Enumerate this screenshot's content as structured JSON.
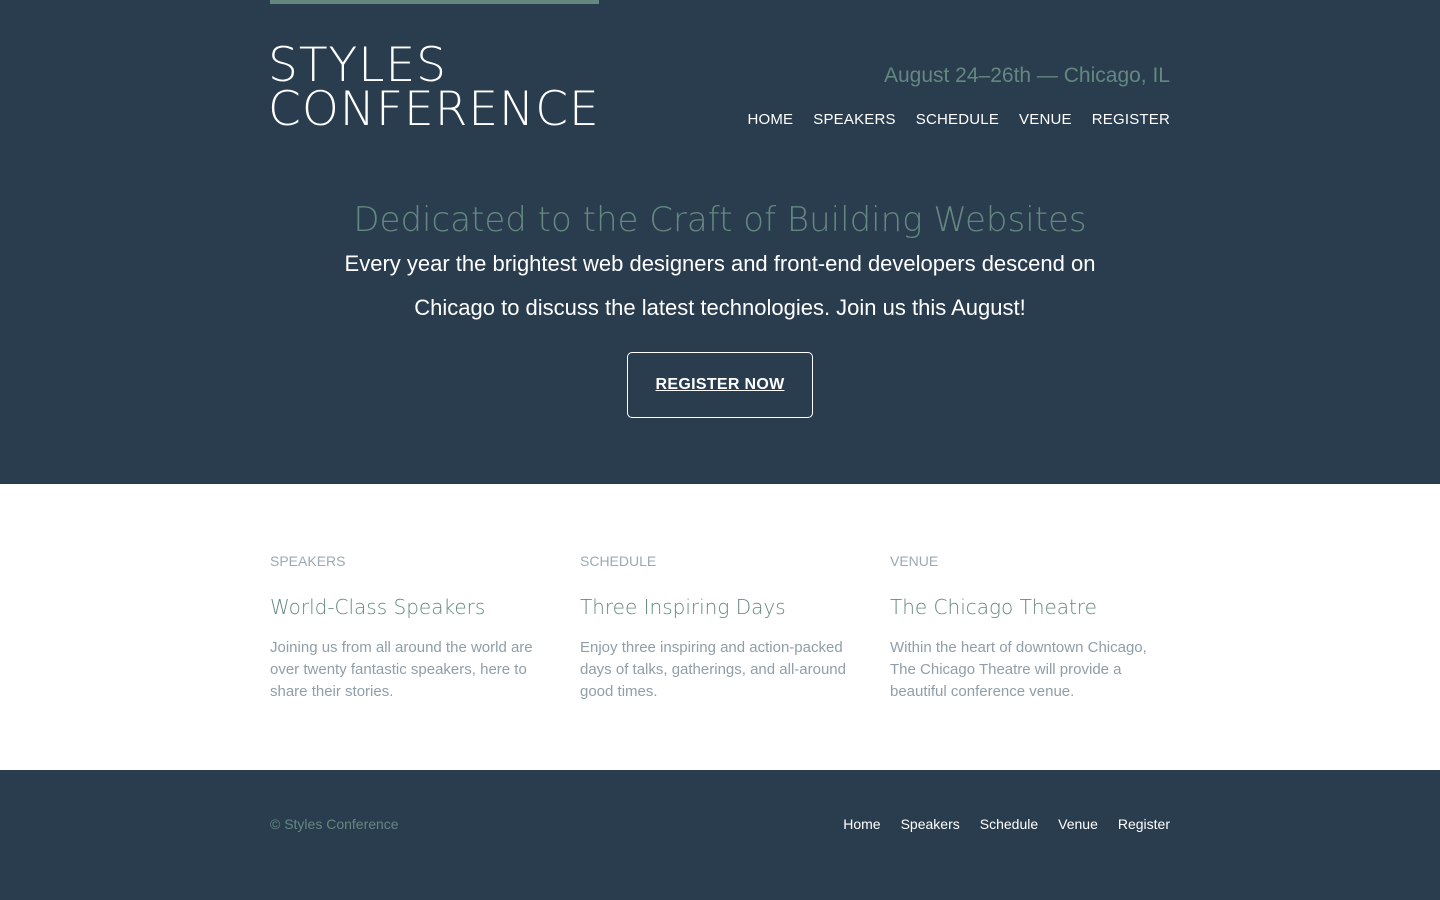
{
  "brand": {
    "line1": "STYLES",
    "line2": "CONFERENCE",
    "tagline": "August 24–26th — Chicago, IL"
  },
  "nav": {
    "items": [
      {
        "label": "HOME"
      },
      {
        "label": "SPEAKERS"
      },
      {
        "label": "SCHEDULE"
      },
      {
        "label": "VENUE"
      },
      {
        "label": "REGISTER"
      }
    ]
  },
  "hero": {
    "title": "Dedicated to the Craft of Building Websites",
    "text": "Every year the brightest web designers and front-end developers descend on Chicago to discuss the latest technologies. Join us this August!",
    "cta_label": "REGISTER NOW"
  },
  "features": [
    {
      "kicker": "SPEAKERS",
      "title": "World-Class Speakers",
      "text": "Joining us from all around the world are over twenty fantastic speakers, here to share their stories."
    },
    {
      "kicker": "SCHEDULE",
      "title": "Three Inspiring Days",
      "text": "Enjoy three inspiring and action-packed days of talks, gatherings, and all-around good times."
    },
    {
      "kicker": "VENUE",
      "title": "The Chicago Theatre",
      "text": "Within the heart of downtown Chicago, The Chicago Theatre will provide a beautiful conference venue."
    }
  ],
  "footer": {
    "copyright": "© Styles Conference",
    "links": [
      {
        "label": "Home"
      },
      {
        "label": "Speakers"
      },
      {
        "label": "Schedule"
      },
      {
        "label": "Venue"
      },
      {
        "label": "Register"
      }
    ]
  },
  "colors": {
    "background": "#2a3d4f",
    "accent": "#648880",
    "muted_text": "#8f9ea8"
  }
}
